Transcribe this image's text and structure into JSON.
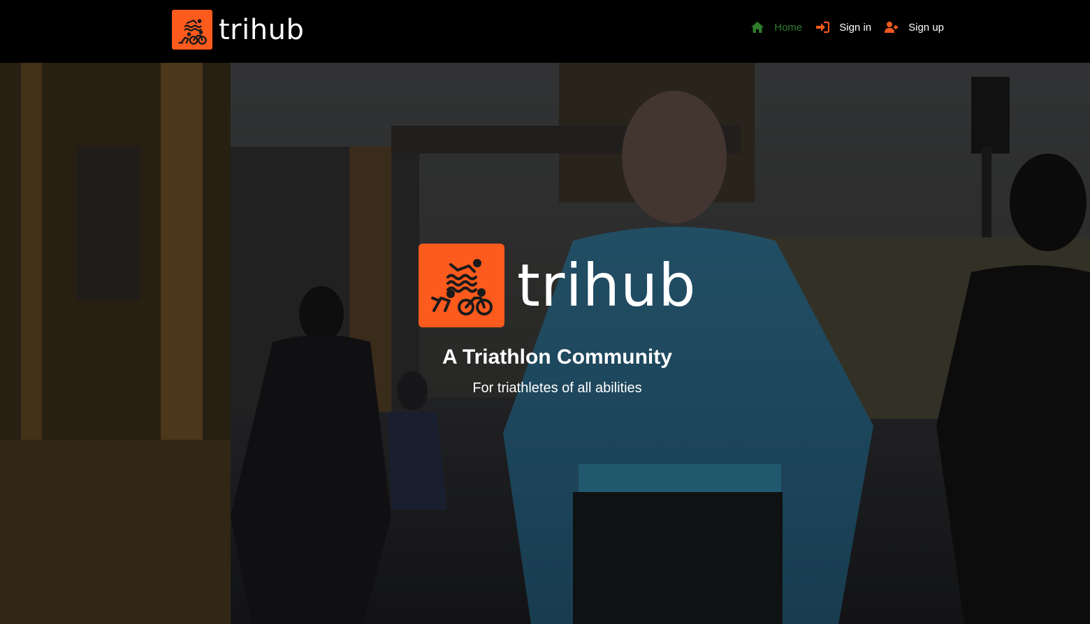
{
  "brand": {
    "name": "trihub",
    "logo_color": "#fd5a1e"
  },
  "nav": {
    "items": [
      {
        "label": "Home",
        "icon": "home-icon",
        "active": true,
        "color": "#2f7d2b"
      },
      {
        "label": "Sign in",
        "icon": "sign-in-icon",
        "color": "#ffffff"
      },
      {
        "label": "Sign up",
        "icon": "user-plus-icon",
        "color": "#ffffff"
      }
    ],
    "icon_color": "#f05a1e"
  },
  "hero": {
    "brand_name": "trihub",
    "title": "A Triathlon Community",
    "subtitle": "For triathletes of all abilities"
  }
}
